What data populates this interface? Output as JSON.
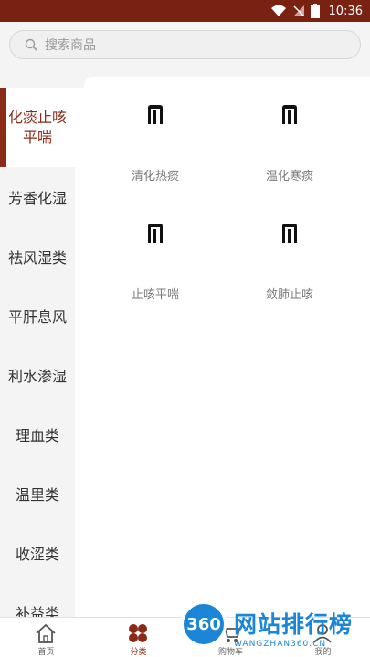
{
  "status_bar": {
    "time": "10:36",
    "icons": [
      "wifi-icon",
      "signal-icon",
      "battery-icon"
    ]
  },
  "search": {
    "placeholder": "搜索商品"
  },
  "sidebar": {
    "items": [
      {
        "label": "化痰止咳\n平喘",
        "active": true
      },
      {
        "label": "芳香化湿"
      },
      {
        "label": "祛风湿类"
      },
      {
        "label": "平肝息风"
      },
      {
        "label": "利水渗湿"
      },
      {
        "label": "理血类"
      },
      {
        "label": "温里类"
      },
      {
        "label": "收涩类"
      },
      {
        "label": "补益类"
      }
    ]
  },
  "grid": {
    "items": [
      {
        "label": "清化热痰"
      },
      {
        "label": "温化寒痰"
      },
      {
        "label": "止咳平喘"
      },
      {
        "label": "敛肺止咳"
      }
    ]
  },
  "tabbar": {
    "tabs": [
      {
        "label": "首页",
        "icon": "home-icon"
      },
      {
        "label": "分类",
        "icon": "category-icon",
        "active": true
      },
      {
        "label": "购物车",
        "icon": "cart-icon"
      },
      {
        "label": "我的",
        "icon": "user-icon"
      }
    ]
  },
  "watermark": {
    "badge": "360",
    "title": "网站排行榜",
    "subtitle": "WANGZHAN360.CN"
  },
  "colors": {
    "accent": "#8b2a17",
    "status_bar": "#7a2212",
    "watermark": "#1b86d8"
  }
}
